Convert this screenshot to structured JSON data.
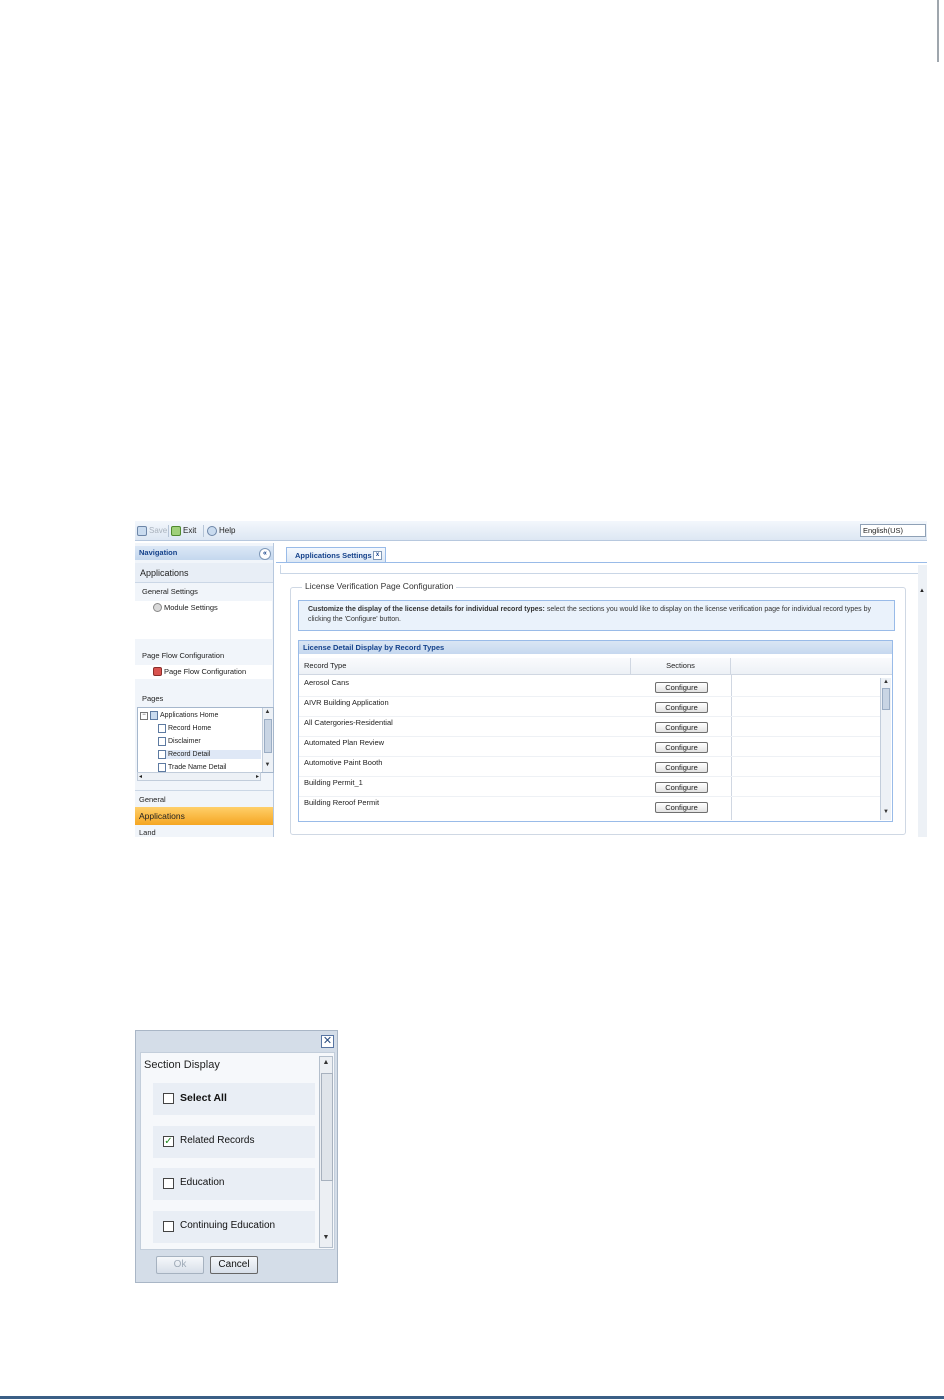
{
  "toolbar": {
    "save_label": "Save",
    "exit_label": "Exit",
    "help_label": "Help",
    "language": "English(US)"
  },
  "navigation": {
    "header": "Navigation",
    "module_title": "Applications",
    "general_settings": "General Settings",
    "module_settings": "Module Settings",
    "page_flow_configuration_header": "Page Flow Configuration",
    "page_flow_configuration": "Page Flow Configuration",
    "pages_header": "Pages",
    "tree": {
      "root": "Applications Home",
      "children": [
        "Record Home",
        "Disclaimer",
        "Record Detail",
        "Trade Name Detail"
      ]
    },
    "sections": {
      "general": "General",
      "applications": "Applications",
      "land": "Land"
    }
  },
  "content": {
    "tab_label": "Applications Settings",
    "fieldset_legend": "License Verification Page Configuration",
    "info_bold": "Customize the display of the license details for individual record types:",
    "info_text": " select the sections you would like to display on the license verification page for individual record types by clicking the 'Configure' button.",
    "grid": {
      "title": "License Detail Display by Record Types",
      "columns": [
        "Record Type",
        "Sections"
      ],
      "rows": [
        {
          "record_type": "Aerosol Cans",
          "action": "Configure"
        },
        {
          "record_type": "AIVR Building Application",
          "action": "Configure"
        },
        {
          "record_type": "All Catergories-Residential",
          "action": "Configure"
        },
        {
          "record_type": "Automated Plan Review",
          "action": "Configure"
        },
        {
          "record_type": "Automotive Paint Booth",
          "action": "Configure"
        },
        {
          "record_type": "Building Permit_1",
          "action": "Configure"
        },
        {
          "record_type": "Building Reroof Permit",
          "action": "Configure"
        }
      ]
    }
  },
  "dialog": {
    "title": "Section Display",
    "options": [
      {
        "label": "Select All",
        "checked": false,
        "bold": true
      },
      {
        "label": "Related Records",
        "checked": true,
        "bold": false
      },
      {
        "label": "Education",
        "checked": false,
        "bold": false
      },
      {
        "label": "Continuing Education",
        "checked": false,
        "bold": false
      }
    ],
    "ok_label": "Ok",
    "cancel_label": "Cancel"
  },
  "colors": {
    "active_section": "#f5a623",
    "header_text": "#15428b",
    "grid_border": "#99bbe8",
    "check_mark": "#1f8a1f"
  },
  "icons": [
    "save-icon",
    "exit-icon",
    "help-icon",
    "collapse-icon",
    "gear-icon",
    "page-flow-icon",
    "document-icon",
    "close-icon",
    "checkmark-icon"
  ]
}
